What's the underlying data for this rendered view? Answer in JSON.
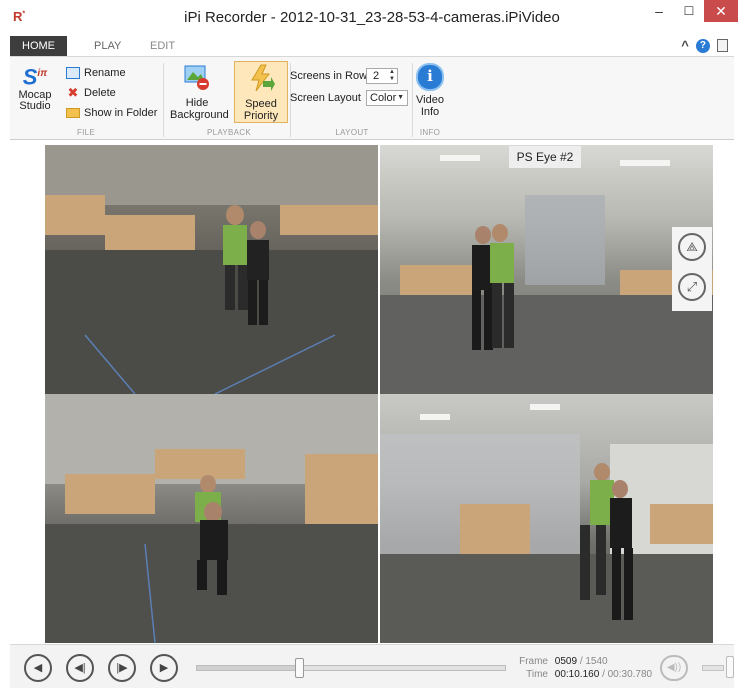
{
  "window": {
    "logo": "R",
    "title": "iPi Recorder - 2012-10-31_23-28-53-4-cameras.iPiVideo",
    "minimize": "–",
    "maximize": "☐",
    "close": "✕"
  },
  "tabs": [
    {
      "label": "HOME"
    },
    {
      "label": "PLAY"
    },
    {
      "label": "EDIT"
    }
  ],
  "ribbon": {
    "file": {
      "mocap_label": "Mocap\nStudio",
      "rename": "Rename",
      "delete": "Delete",
      "show_in_folder": "Show in Folder",
      "group": "FILE"
    },
    "playback": {
      "hide_background": "Hide Background",
      "speed_priority": "Speed Priority",
      "group": "PLAYBACK"
    },
    "layout": {
      "screens_in_row_label": "Screens in Row",
      "screens_in_row_value": "2",
      "screen_layout_label": "Screen Layout",
      "screen_layout_value": "Color",
      "group": "LAYOUT"
    },
    "info": {
      "video_info": "Video Info",
      "group": "INFO"
    }
  },
  "video": {
    "camera_label": "PS Eye #2"
  },
  "playback": {
    "progress_fraction": 0.33,
    "frame_label": "Frame",
    "frame_current": "0509",
    "frame_total": "/ 1540",
    "time_label": "Time",
    "time_current": "00:10.160",
    "time_total": "/ 00:30.780"
  },
  "colors": {
    "accent": "#2a7bd4",
    "close": "#c94b4b",
    "active_tab": "#3d3d3d",
    "speed_priority_bg": "#fde7bb"
  }
}
